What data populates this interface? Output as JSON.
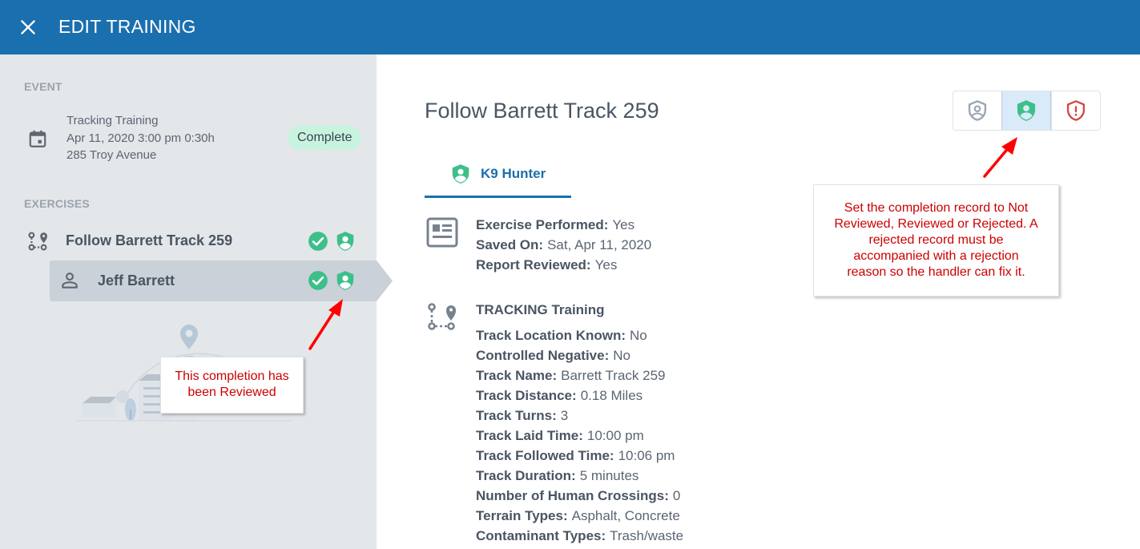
{
  "header": {
    "title": "EDIT TRAINING",
    "close_icon": "close-icon"
  },
  "sidebar": {
    "event_label": "EVENT",
    "event": {
      "name": "Tracking Training",
      "datetime": "Apr 11, 2020 3:00 pm 0:30h",
      "location": "285 Troy Avenue",
      "status": "Complete",
      "icon": "calendar-icon"
    },
    "exercises_label": "EXERCISES",
    "exercise": {
      "name": "Follow Barrett Track 259",
      "icon": "route-icon",
      "status_icons": [
        "check-circle-icon",
        "shield-person-icon"
      ]
    },
    "handler": {
      "name": "Jeff Barrett",
      "icon": "person-icon",
      "status_icons": [
        "check-circle-icon",
        "shield-person-icon"
      ]
    }
  },
  "annotations": {
    "reviewed_note": [
      "This completion has",
      "been Reviewed"
    ],
    "review_buttons_note": [
      "Set the completion record to Not",
      "Reviewed, Reviewed or Rejected. A",
      "rejected record must be",
      "accompanied with a rejection",
      "reason so the handler can fix it."
    ]
  },
  "main": {
    "title": "Follow Barrett Track 259",
    "review_buttons": [
      {
        "name": "Not Reviewed",
        "icon": "shield-person-outline-icon",
        "active": false
      },
      {
        "name": "Reviewed",
        "icon": "shield-person-icon",
        "active": true
      },
      {
        "name": "Rejected",
        "icon": "shield-alert-icon",
        "active": false
      }
    ],
    "tab": {
      "label": "K9 Hunter",
      "icon": "shield-person-icon"
    },
    "summary": [
      {
        "k": "Exercise Performed:",
        "v": "Yes"
      },
      {
        "k": "Saved On:",
        "v": "Sat, Apr 11, 2020"
      },
      {
        "k": "Report Reviewed:",
        "v": "Yes"
      }
    ],
    "details_heading": "TRACKING Training",
    "details": [
      {
        "k": "Track Location Known:",
        "v": "No"
      },
      {
        "k": "Controlled Negative:",
        "v": "No"
      },
      {
        "k": "Track Name:",
        "v": "Barrett Track 259"
      },
      {
        "k": "Track Distance:",
        "v": "0.18 Miles"
      },
      {
        "k": "Track Turns:",
        "v": "3"
      },
      {
        "k": "Track Laid Time:",
        "v": "10:00 pm"
      },
      {
        "k": "Track Followed Time:",
        "v": "10:06 pm"
      },
      {
        "k": "Track Duration:",
        "v": "5 minutes"
      },
      {
        "k": "Number of Human Crossings:",
        "v": "0"
      },
      {
        "k": "Terrain Types:",
        "v": "Asphalt, Concrete"
      },
      {
        "k": "Contaminant Types:",
        "v": "Trash/waste"
      }
    ]
  },
  "colors": {
    "header": "#1a6fae",
    "accent_green": "#3dbf8a",
    "reject_red": "#d64545",
    "sidebar_bg": "#e3e7ea",
    "annotation_red": "#cc0000"
  }
}
